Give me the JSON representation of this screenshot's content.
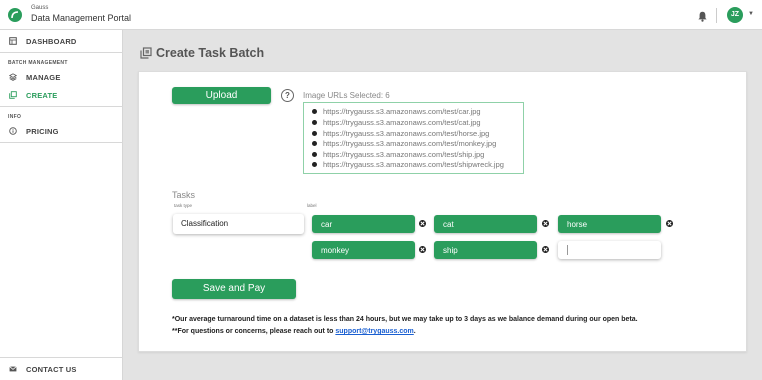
{
  "header": {
    "brand_small": "Gauss",
    "brand_main": "Data Management Portal",
    "avatar_initials": "JZ",
    "accent_color": "#2a9d5c"
  },
  "sidebar": {
    "dashboard": "DASHBOARD",
    "section_batch": "BATCH MANAGEMENT",
    "manage": "MANAGE",
    "create": "CREATE",
    "section_info": "INFO",
    "pricing": "PRICING",
    "contact": "CONTACT US"
  },
  "page": {
    "title": "Create Task Batch"
  },
  "upload": {
    "button": "Upload",
    "help": "?",
    "selected_label": "Image URLs Selected: 6",
    "urls": [
      "https://trygauss.s3.amazonaws.com/test/car.jpg",
      "https://trygauss.s3.amazonaws.com/test/cat.jpg",
      "https://trygauss.s3.amazonaws.com/test/horse.jpg",
      "https://trygauss.s3.amazonaws.com/test/monkey.jpg",
      "https://trygauss.s3.amazonaws.com/test/ship.jpg",
      "https://trygauss.s3.amazonaws.com/test/shipwreck.jpg"
    ]
  },
  "tasks": {
    "heading": "Tasks",
    "task_type_label": "task type",
    "label_label": "label",
    "task_type_value": "Classification",
    "labels": [
      "car",
      "cat",
      "horse",
      "monkey",
      "ship"
    ]
  },
  "actions": {
    "save_pay": "Save and Pay"
  },
  "notes": {
    "line1": "*Our average turnaround time on a dataset is less than 24 hours, but we may take up to 3 days as we balance demand during our open beta.",
    "line2_prefix": "**For questions or concerns, please reach out to ",
    "email": "support@trygauss.com",
    "line2_suffix": "."
  }
}
